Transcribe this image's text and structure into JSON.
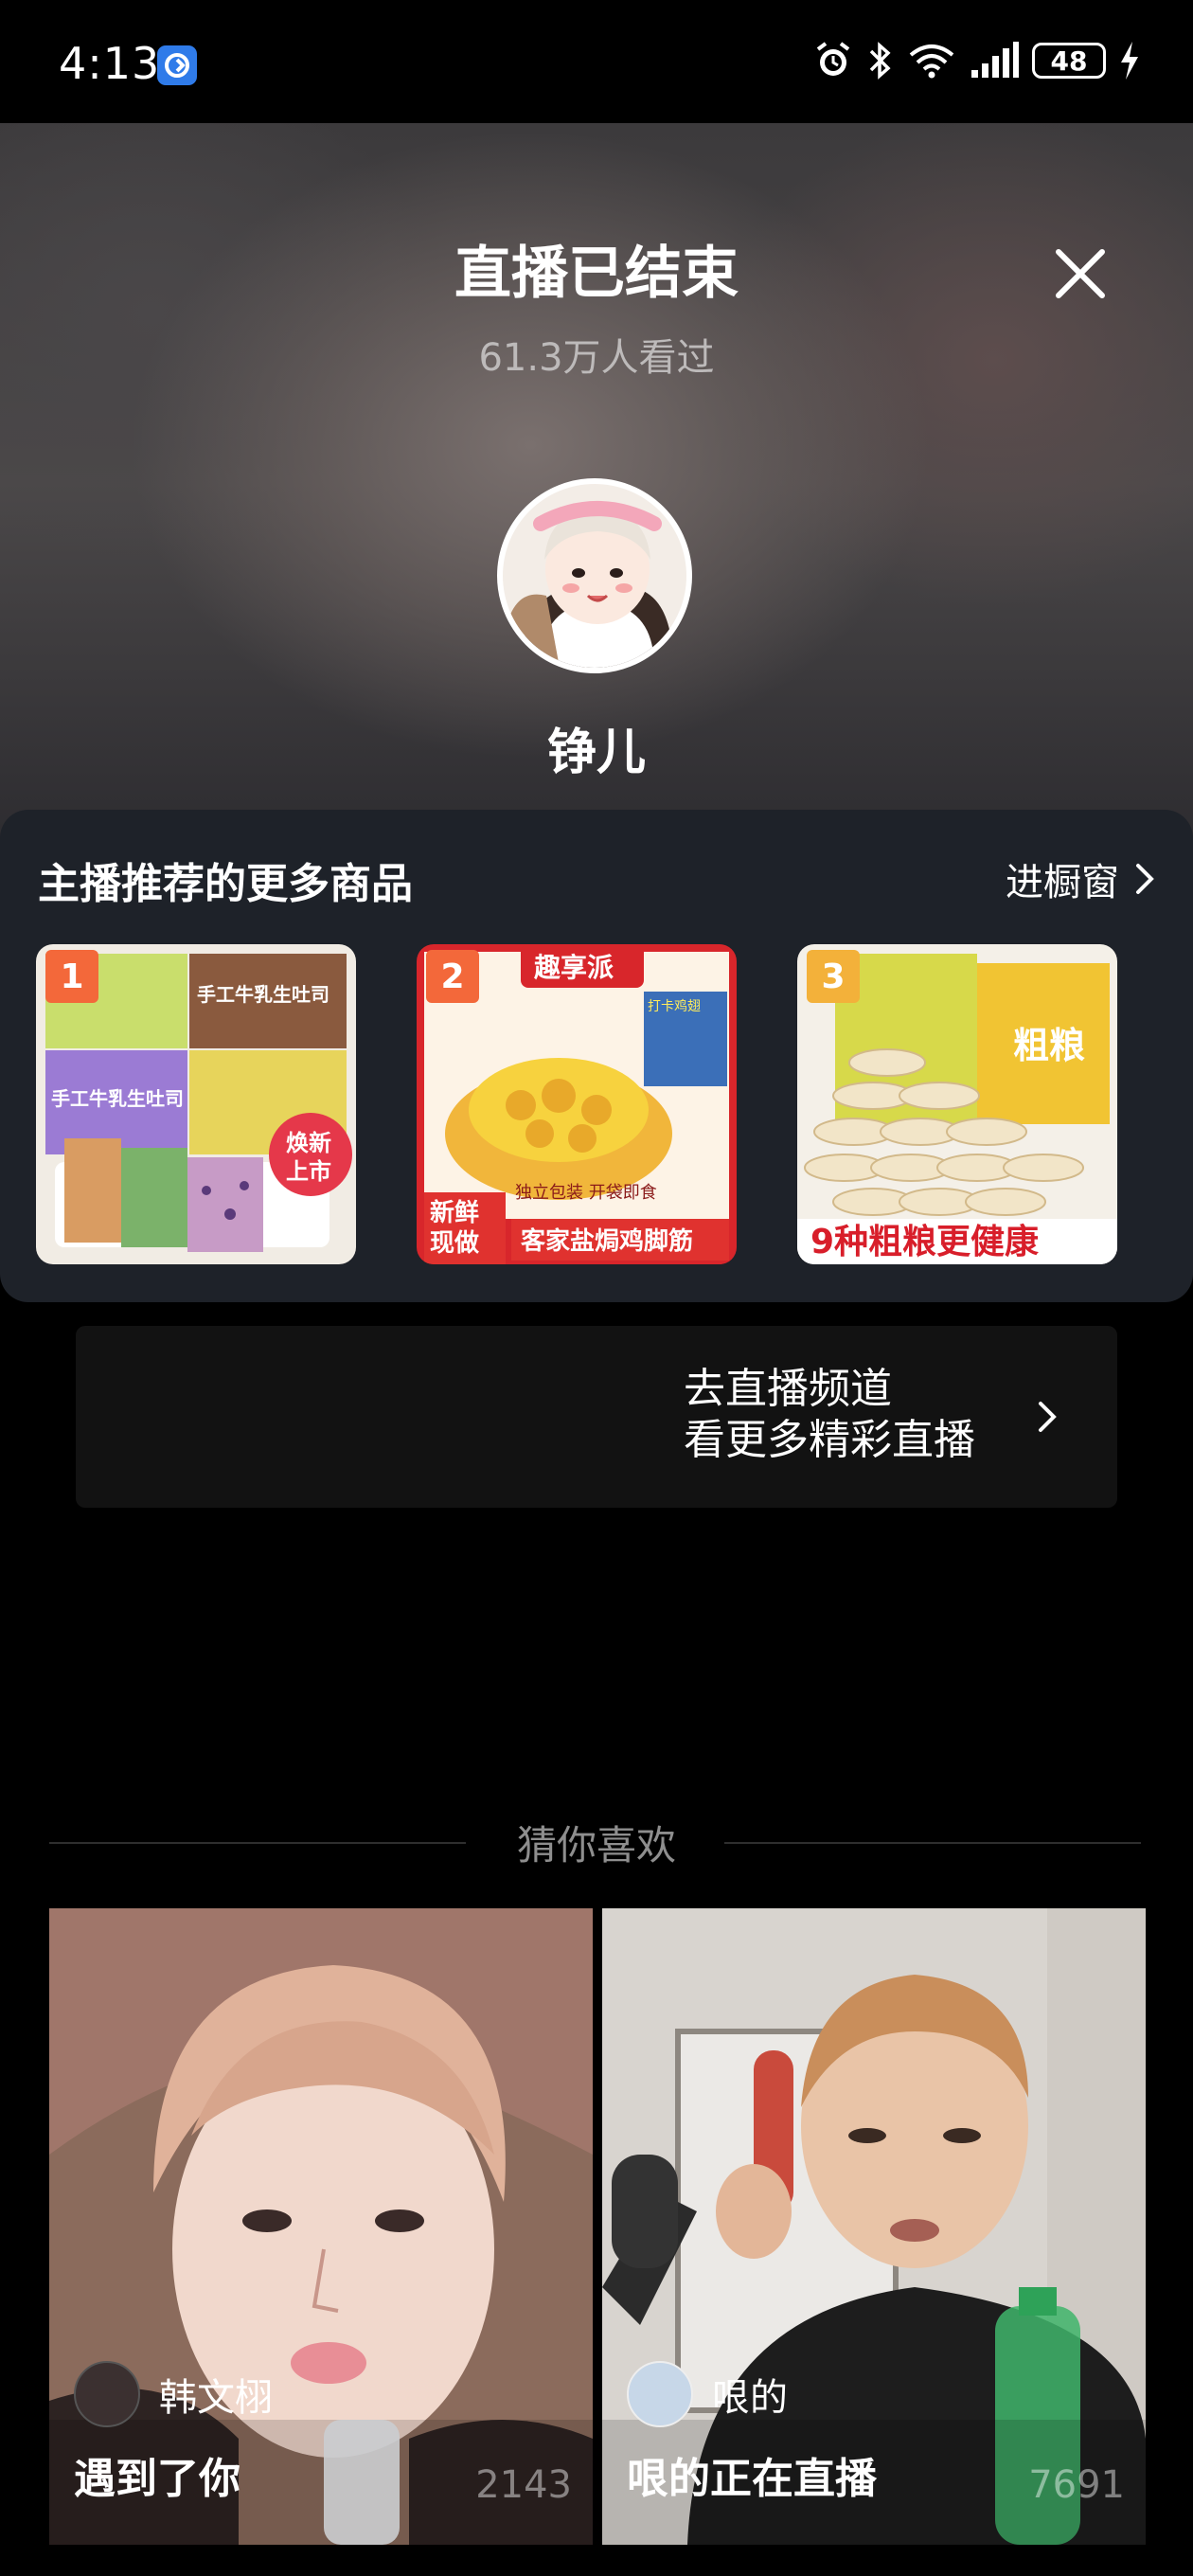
{
  "status_bar": {
    "time": "4:13",
    "battery": "48"
  },
  "header": {
    "title": "直播已结束",
    "viewers": "61.3万人看过",
    "anchor_name": "铮儿"
  },
  "products_panel": {
    "title": "主播推荐的更多商品",
    "link": "进橱窗",
    "items": [
      {
        "rank": "1",
        "badge": "焕新上市",
        "label_a": "手工牛乳生吐司",
        "label_b": "手工牛乳生吐司"
      },
      {
        "rank": "2",
        "brand": "趣享派",
        "tag": "新鲜现做",
        "subtitle": "独立包装 开袋即食",
        "caption": "客家盐焗鸡脚筋",
        "pack": "打卡鸡翅"
      },
      {
        "rank": "3",
        "caption": "9种粗粮更健康",
        "pack": "粗粮"
      }
    ]
  },
  "channel": {
    "line1": "去直播频道",
    "line2": "看更多精彩直播"
  },
  "recommend": {
    "title": "猜你喜欢",
    "cards": [
      {
        "user": "韩文栩",
        "caption": "遇到了你",
        "count": "2143"
      },
      {
        "user": "哏的",
        "caption": "哏的正在直播",
        "count": "7691"
      }
    ]
  }
}
